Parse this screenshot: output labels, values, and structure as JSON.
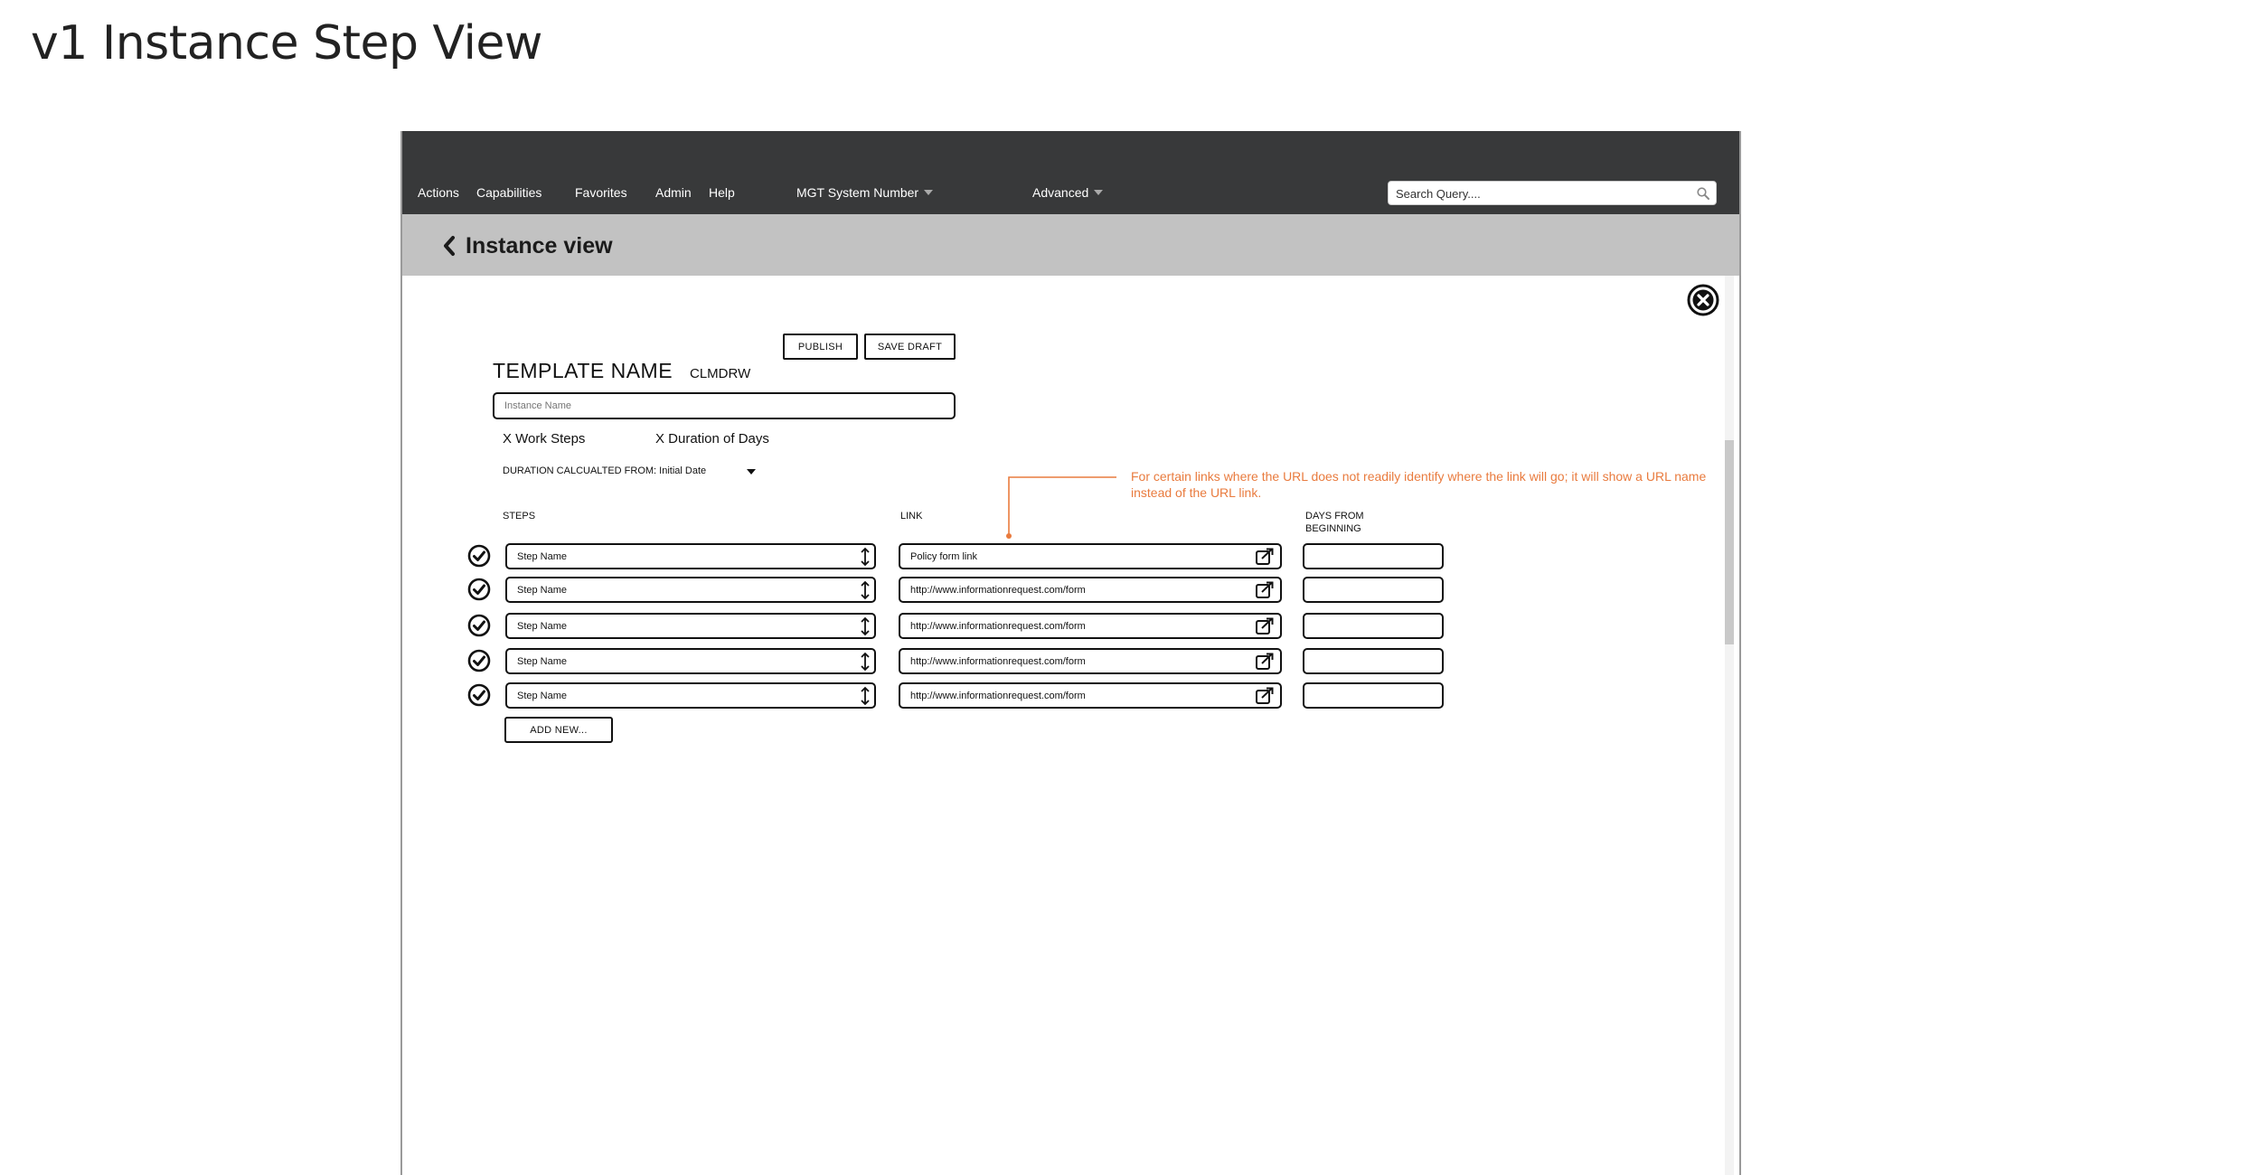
{
  "page": {
    "heading": "v1 Instance Step View"
  },
  "nav": {
    "items": [
      "Actions",
      "Capabilities",
      "Favorites",
      "Admin",
      "Help"
    ],
    "system_dropdown": "MGT System Number",
    "advanced_dropdown": "Advanced",
    "search": {
      "placeholder": "Search Query....",
      "icon": "search-icon"
    },
    "colors": {
      "bar": "#38393a"
    }
  },
  "subheader": {
    "title": "Instance view",
    "back_icon": "chevron-left-icon",
    "color": "#c2c2c2"
  },
  "toolbar": {
    "publish_label": "PUBLISH",
    "save_draft_label": "SAVE DRAFT",
    "close_icon": "close-circle-icon"
  },
  "template": {
    "name_label": "TEMPLATE NAME",
    "code": "CLMDRW",
    "instance_name_placeholder": "Instance Name",
    "work_steps": "X Work Steps",
    "duration": "X Duration of Days",
    "duration_calc_label": "DURATION CALCUALTED FROM: Initial Date"
  },
  "annotation": {
    "text": "For certain links where the URL does not readily identify where the link will go; it will show a URL name instead of the URL link.",
    "color": "#e97b3e"
  },
  "columns": {
    "steps": "STEPS",
    "link": "LINK",
    "days_from_beginning": "DAYS FROM BEGINNING"
  },
  "steps": [
    {
      "name": "Step Name",
      "link": "Policy form link",
      "days": ""
    },
    {
      "name": "Step Name",
      "link": "http://www.informationrequest.com/form",
      "days": ""
    },
    {
      "name": "Step Name",
      "link": "http://www.informationrequest.com/form",
      "days": ""
    },
    {
      "name": "Step Name",
      "link": "http://www.informationrequest.com/form",
      "days": ""
    },
    {
      "name": "Step Name",
      "link": "http://www.informationrequest.com/form",
      "days": ""
    }
  ],
  "add_new_label": "ADD NEW..."
}
